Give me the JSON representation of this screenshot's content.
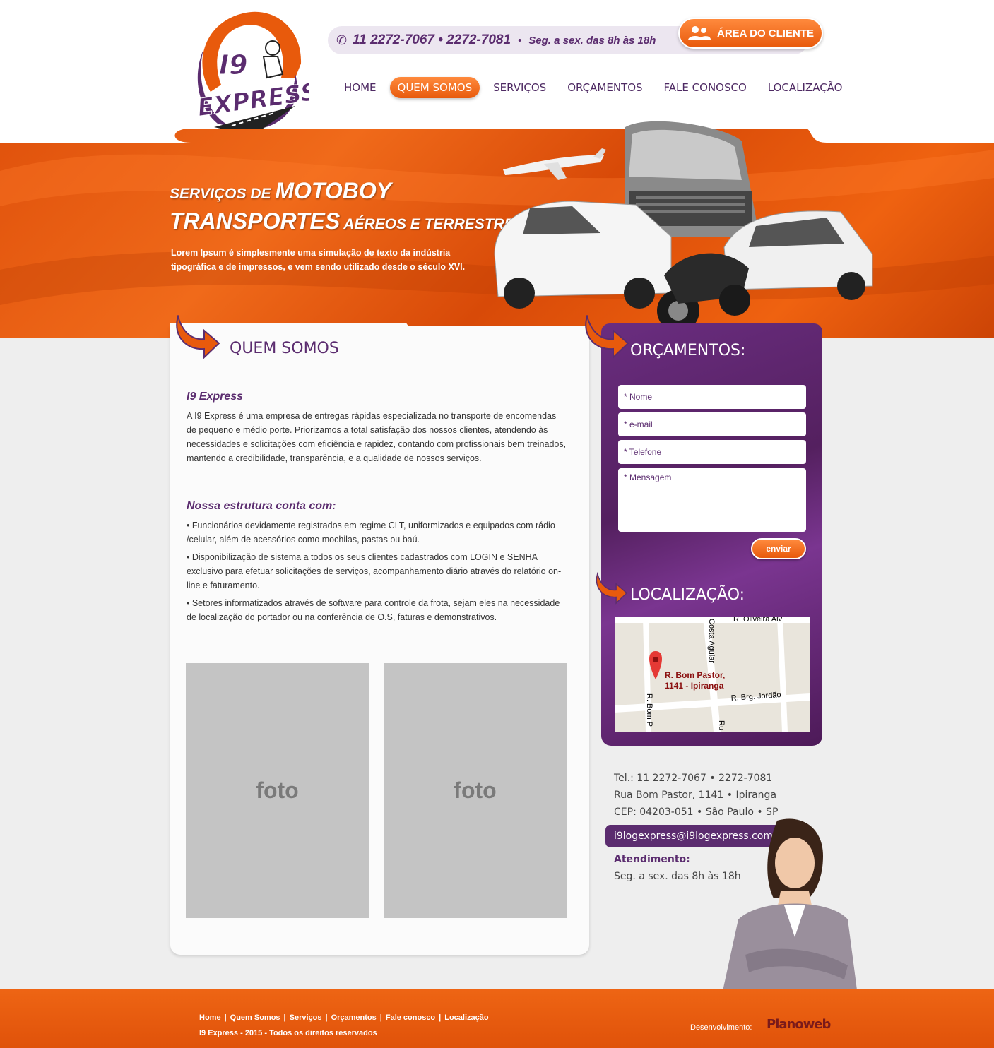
{
  "header": {
    "logo_text_top": "I9",
    "logo_text_bottom": "EXPRESS",
    "phones": "11 2272-7067 • 2272-7081",
    "phone_separator": "•",
    "hours": "Seg. a sex. das 8h às 18h",
    "area_cliente_label": "ÁREA DO CLIENTE",
    "nav": [
      {
        "label": "HOME",
        "active": false
      },
      {
        "label": "QUEM SOMOS",
        "active": true
      },
      {
        "label": "SERVIÇOS",
        "active": false
      },
      {
        "label": "ORÇAMENTOS",
        "active": false
      },
      {
        "label": "FALE CONOSCO",
        "active": false
      },
      {
        "label": "LOCALIZAÇÃO",
        "active": false
      }
    ]
  },
  "banner": {
    "line1_small": "SERVIÇOS DE ",
    "line1_big": "MOTOBOY",
    "line2_big": "TRANSPORTES",
    "line2_small": " AÉREOS E TERRESTRES",
    "text": "Lorem Ipsum é simplesmente uma simulação de texto da indústria tipográfica e de impressos, e vem sendo utilizado desde o século XVI."
  },
  "main": {
    "section_title": "QUEM SOMOS",
    "about_heading": "I9 Express",
    "about_text": "A I9 Express é uma empresa de entregas rápidas especializada no transporte de encomendas de pequeno e médio porte. Priorizamos a total satisfação dos nossos clientes, atendendo às necessidades e solicitações com eficiência e rapidez, contando com profissionais bem treinados, mantendo a credibilidade, transparência, e a qualidade de nossos serviços.",
    "structure_heading": "Nossa estrutura conta com:",
    "structure_items": [
      "• Funcionários devidamente registrados em regime CLT, uniformizados e equipados com rádio /celular, além de acessórios como mochilas, pastas ou baú.",
      "• Disponibilização de sistema a todos os seus clientes cadastrados com LOGIN e SENHA exclusivo para efetuar solicitações de serviços, acompanhamento diário através do relatório on-line e faturamento.",
      "• Setores informatizados através de software para controle da frota, sejam eles na necessidade de localização do portador ou na conferência de O.S, faturas e demonstrativos."
    ],
    "photo_1_label": "foto",
    "photo_2_label": "foto"
  },
  "sidebar": {
    "orcamentos_title": "ORÇAMENTOS:",
    "form": {
      "nome_placeholder": "* Nome",
      "email_placeholder": "* e-mail",
      "telefone_placeholder": "* Telefone",
      "mensagem_placeholder": "* Mensagem",
      "submit_label": "enviar"
    },
    "localizacao_title": "LOCALIZAÇÃO:",
    "map": {
      "street_top": "R. Oliveira Alv",
      "street_vertical": "Costa Aguiar",
      "street_brg": "R. Brg. Jordão",
      "street_bom_pastor": "R. Bom P",
      "street_ru": "Ru",
      "pin_label_line1": "R. Bom Pastor,",
      "pin_label_line2": "1141 - Ipiranga"
    }
  },
  "contact": {
    "tel": "Tel.: 11 2272-7067 • 2272-7081",
    "address": "Rua Bom Pastor, 1141 • Ipiranga",
    "cep": "CEP: 04203-051 • São Paulo • SP",
    "email": "i9logexpress@i9logexpress.com.br",
    "atendimento_label": "Atendimento:",
    "atendimento_hours": "Seg. a sex. das 8h às 18h"
  },
  "footer": {
    "nav": [
      "Home",
      "Quem Somos",
      "Serviços",
      "Orçamentos",
      "Fale conosco",
      "Localização"
    ],
    "separator": "|",
    "copyright": "I9 Express - 2015 - Todos os direitos reservados",
    "dev_label": "Desenvolvimento:",
    "dev_logo": "Planoweb"
  },
  "colors": {
    "brand_purple": "#5b2c6f",
    "brand_orange": "#e85a0c",
    "photo_placeholder": "#c4c4c4"
  }
}
